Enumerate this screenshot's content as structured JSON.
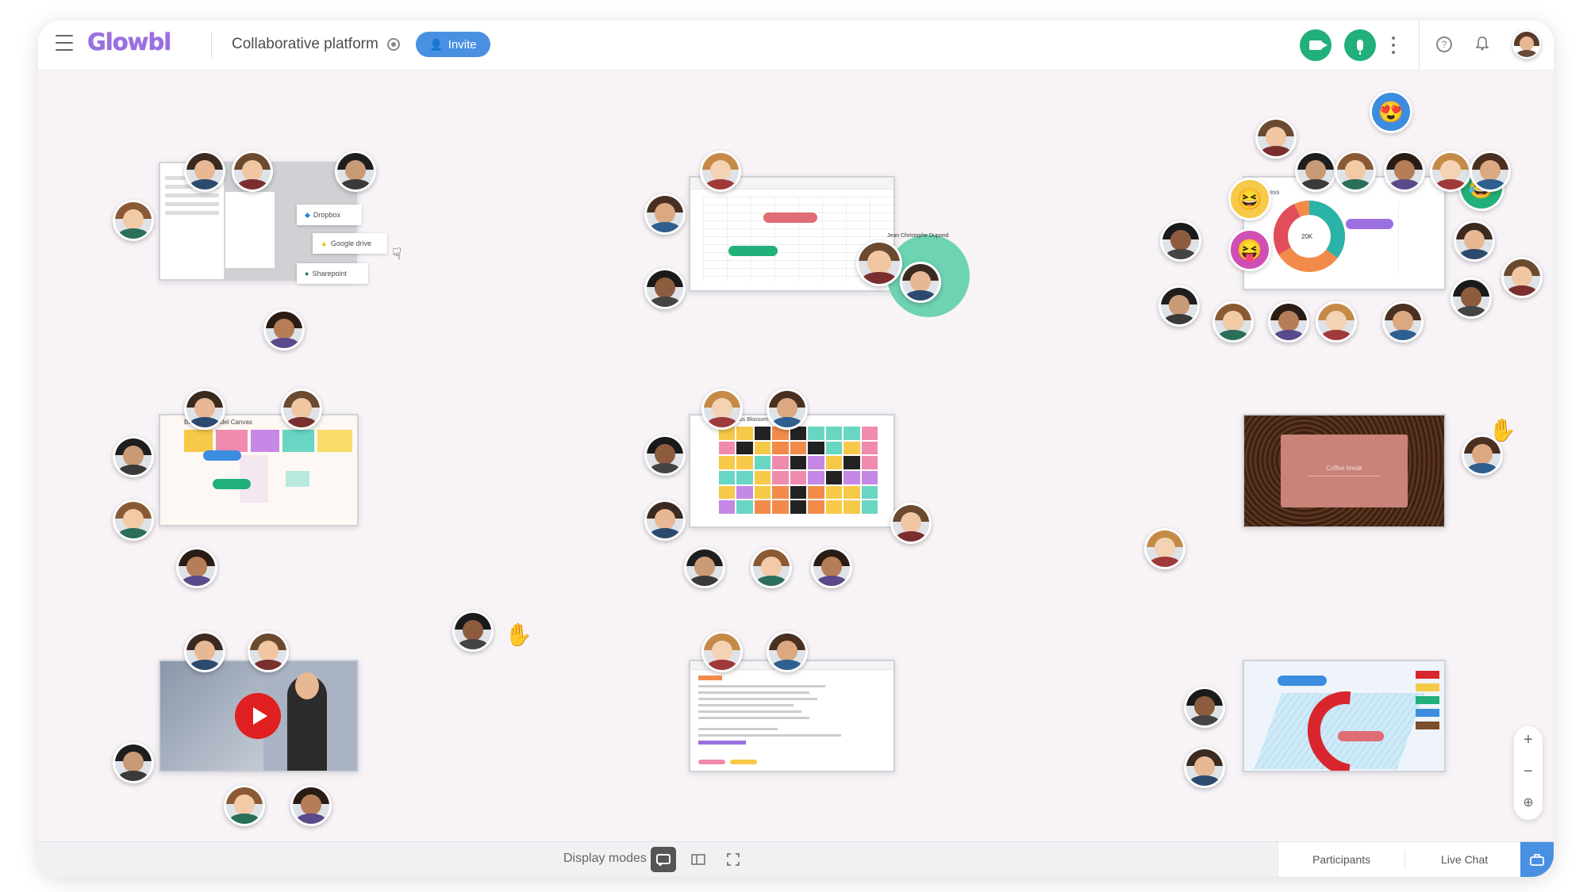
{
  "header": {
    "logo_text": "Glowbl",
    "title": "Collaborative platform",
    "invite_label": "Invite",
    "help_glyph": "?"
  },
  "colors": {
    "accent": "#4a90e2",
    "brand": "#9b6fe0",
    "media_on": "#21b07a"
  },
  "icons": {
    "menu": "hamburger-icon",
    "settings": "gear-icon",
    "invite": "add-user-icon",
    "camera": "video-camera-icon",
    "microphone": "microphone-icon",
    "more": "kebab-icon",
    "help": "help-icon",
    "notifications": "bell-icon",
    "zoom_in": "plus-icon",
    "zoom_out": "minus-icon",
    "recenter": "locate-icon",
    "share_panel": "share-panel-icon",
    "pointer": "hand-cursor-icon"
  },
  "bottombar": {
    "display_modes_label": "Display modes",
    "tabs": [
      "Participants",
      "Live Chat"
    ]
  },
  "zoom": {
    "in": "+",
    "out": "−"
  },
  "workspaces": {
    "drive": {
      "items": [
        "Dropbox",
        "Google drive",
        "Sharepoint"
      ]
    },
    "spreadsheet": {
      "host_name": "Jean Christophe Dupond"
    },
    "chart": {
      "title": "Business",
      "center_value": "20K"
    },
    "canvas": {
      "title": "Business Model Canvas"
    },
    "lotus": {
      "title": "Lotus Blossom Technique"
    },
    "coffee": {
      "card_text": "Coffee break"
    }
  }
}
